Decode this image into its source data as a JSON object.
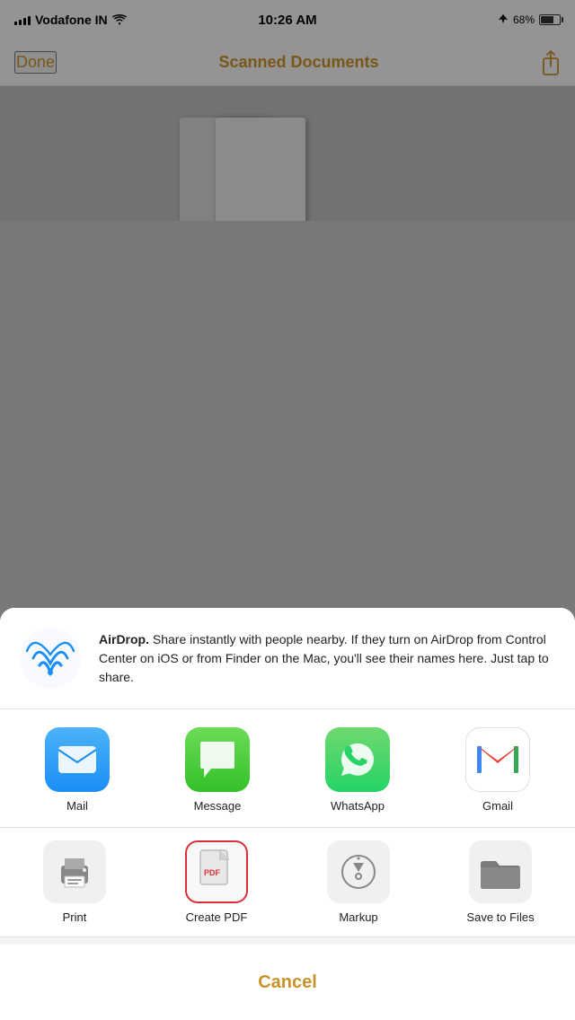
{
  "statusBar": {
    "carrier": "Vodafone IN",
    "time": "10:26 AM",
    "battery": "68%",
    "batteryLevel": 68
  },
  "navBar": {
    "doneLabel": "Done",
    "title": "Scanned Documents",
    "shareAriaLabel": "Share"
  },
  "airdrop": {
    "text_bold": "AirDrop.",
    "text_body": " Share instantly with people nearby. If they turn on AirDrop from Control Center on iOS or from Finder on the Mac, you'll see their names here. Just tap to share."
  },
  "apps": [
    {
      "id": "mail",
      "label": "Mail"
    },
    {
      "id": "message",
      "label": "Message"
    },
    {
      "id": "whatsapp",
      "label": "WhatsApp"
    },
    {
      "id": "gmail",
      "label": "Gmail"
    }
  ],
  "actions": [
    {
      "id": "print",
      "label": "Print"
    },
    {
      "id": "create-pdf",
      "label": "Create PDF",
      "highlighted": true
    },
    {
      "id": "markup",
      "label": "Markup"
    },
    {
      "id": "save-to-files",
      "label": "Save to Files"
    }
  ],
  "cancelLabel": "Cancel"
}
